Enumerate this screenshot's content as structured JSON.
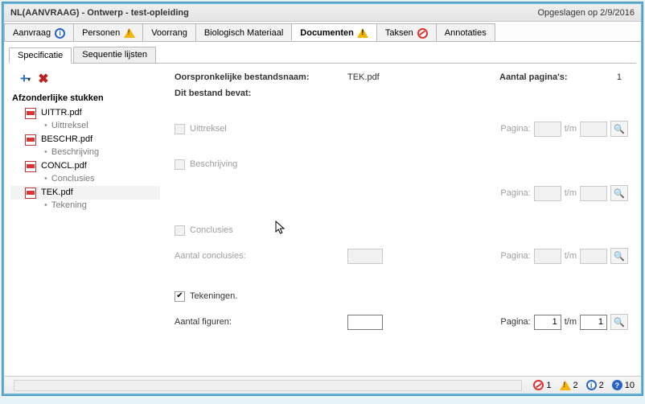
{
  "title": "NL(AANVRAAG) - Ontwerp - test-opleiding",
  "saved": "Opgeslagen op 2/9/2016",
  "mainTabs": {
    "t0": "Aanvraag",
    "t1": "Personen",
    "t2": "Voorrang",
    "t3": "Biologisch Materiaal",
    "t4": "Documenten",
    "t5": "Taksen",
    "t6": "Annotaties"
  },
  "subTabs": {
    "s0": "Specificatie",
    "s1": "Sequentie lijsten"
  },
  "sidebar": {
    "title": "Afzonderlijke stukken",
    "items": [
      {
        "file": "UITTR.pdf",
        "kind": "Uittreksel"
      },
      {
        "file": "BESCHR.pdf",
        "kind": "Beschrijving"
      },
      {
        "file": "CONCL.pdf",
        "kind": "Conclusies"
      },
      {
        "file": "TEK.pdf",
        "kind": "Tekening"
      }
    ]
  },
  "detail": {
    "origLabel": "Oorspronkelijke bestandsnaam:",
    "origValue": "TEK.pdf",
    "pagesLabel": "Aantal pagina's:",
    "pagesValue": "1",
    "containsLabel": "Dit bestand bevat:",
    "sections": {
      "uit": "Uittreksel",
      "bes": "Beschrijving",
      "con": "Conclusies",
      "conCount": "Aantal conclusies:",
      "tek": "Tekeningen.",
      "figCount": "Aantal figuren:"
    },
    "pageLabel": "Pagina:",
    "toLabel": "t/m",
    "tekFrom": "1",
    "tekTo": "1",
    "figValue": ""
  },
  "status": {
    "stop": "1",
    "warn": "2",
    "info": "2",
    "q": "10"
  }
}
